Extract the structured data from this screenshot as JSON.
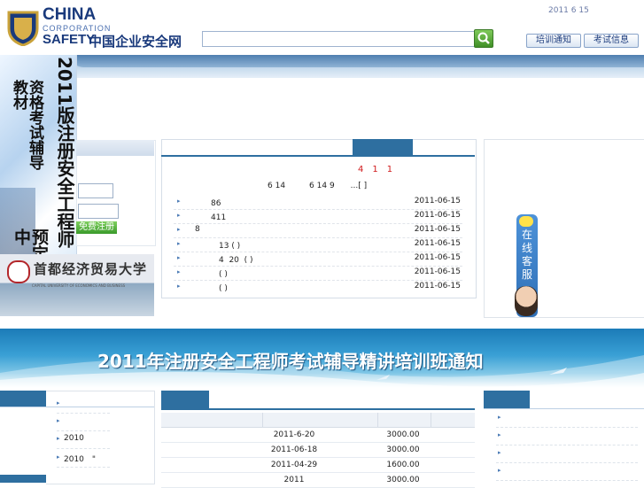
{
  "header": {
    "logo_line1": "CHINA",
    "logo_line2": "CORPORATION",
    "logo_line3": "SAFETY",
    "logo_cn": "中国企业安全网",
    "date": "2011 6 15",
    "search_value": "",
    "btn_training": "培训通知",
    "btn_exam": "考试信息"
  },
  "promo": {
    "line_main": "2011版注册安全工程师",
    "line_sub": "资格考试辅导教材",
    "line_tail": "预定中"
  },
  "login": {
    "register_label": "免费注册"
  },
  "university": {
    "name": "首都经济贸易大学",
    "name_en": "CAPITAL UNIVERSITY OF ECONOMICS AND BUSINESS"
  },
  "news": {
    "headline": "　　　　　　　　　　4　1　1",
    "summary": "6 14　　　6 14  9　　...[ ]",
    "items": [
      {
        "title": "　　86",
        "date": "2011-06-15"
      },
      {
        "title": "　　411",
        "date": "2011-06-15"
      },
      {
        "title": "8",
        "date": "2011-06-15"
      },
      {
        "title": "　　　13 ( )",
        "date": "2011-06-15"
      },
      {
        "title": "　　　4  20  ( )",
        "date": "2011-06-15"
      },
      {
        "title": "　　　( )",
        "date": "2011-06-15"
      },
      {
        "title": "　　　( )",
        "date": "2011-06-15"
      }
    ]
  },
  "service": {
    "label": "在线客服"
  },
  "banner": {
    "text": "2011年注册安全工程师考试辅导精讲培训班通知"
  },
  "bottom_left": {
    "items": [
      "",
      "",
      "2010",
      "2010　\""
    ]
  },
  "bottom_table": {
    "rows": [
      {
        "date": "2011-6-20",
        "amount": "3000.00"
      },
      {
        "date": "2011-06-18",
        "amount": "3000.00"
      },
      {
        "date": "2011-04-29",
        "amount": "1600.00"
      },
      {
        "date": "2011",
        "amount": "3000.00"
      }
    ]
  }
}
